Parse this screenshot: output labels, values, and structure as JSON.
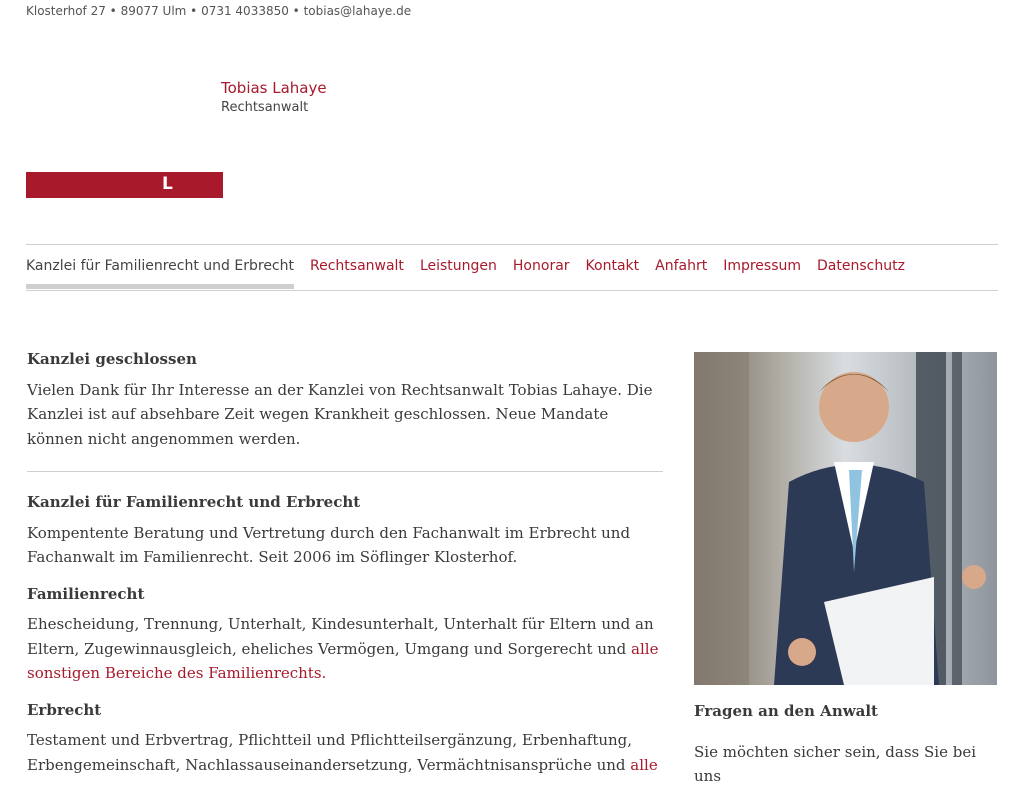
{
  "header": {
    "contact_line": "Klosterhof 27 • 89077 Ulm • 0731 4033850 • tobias@lahaye.de",
    "name": "Tobias Lahaye",
    "subtitle": "Rechtsanwalt",
    "logo_letter": "L"
  },
  "nav": {
    "items": [
      {
        "label": "Kanzlei für Familienrecht und Erbrecht",
        "active": true
      },
      {
        "label": "Rechtsanwalt"
      },
      {
        "label": "Leistungen"
      },
      {
        "label": "Honorar"
      },
      {
        "label": "Kontakt"
      },
      {
        "label": "Anfahrt"
      },
      {
        "label": "Impressum"
      },
      {
        "label": "Datenschutz"
      }
    ]
  },
  "main": {
    "closed_title": "Kanzlei geschlossen",
    "closed_text": "Vielen Dank für Ihr Interesse an der Kanzlei von Rechtsanwalt Tobias Lahaye. Die Kanzlei ist auf absehbare Zeit wegen Krankheit geschlossen. Neue Mandate können nicht angenommen werden.",
    "firm_title": "Kanzlei für Familienrecht und Erbrecht",
    "firm_text": "Kompentente Beratung und Vertretung durch den Fachanwalt im Erbrecht und Fachanwalt im Familienrecht. Seit 2006 im Söflinger Klosterhof.",
    "family_title": "Familienrecht",
    "family_text": "Ehescheidung, Trennung, Unterhalt, Kindesunterhalt, Unterhalt für Eltern und an Eltern, Zugewinnausgleich, eheliches Vermögen, Umgang und Sorgerecht und ",
    "family_link": "alle sonstigen Bereiche des Familienrechts.",
    "inherit_title": "Erbrecht",
    "inherit_text": "Testament und Erbvertrag, Pflichtteil und Pflichtteilsergänzung, Erbenhaftung, Erbengemeinschaft, Nachlassauseinandersetzung, Vermächtnisansprüche und ",
    "inherit_link": "alle"
  },
  "sidebar": {
    "title": "Fragen an den Anwalt",
    "text": "Sie möchten sicher sein, dass Sie bei uns"
  },
  "colors": {
    "accent": "#a8192c"
  }
}
